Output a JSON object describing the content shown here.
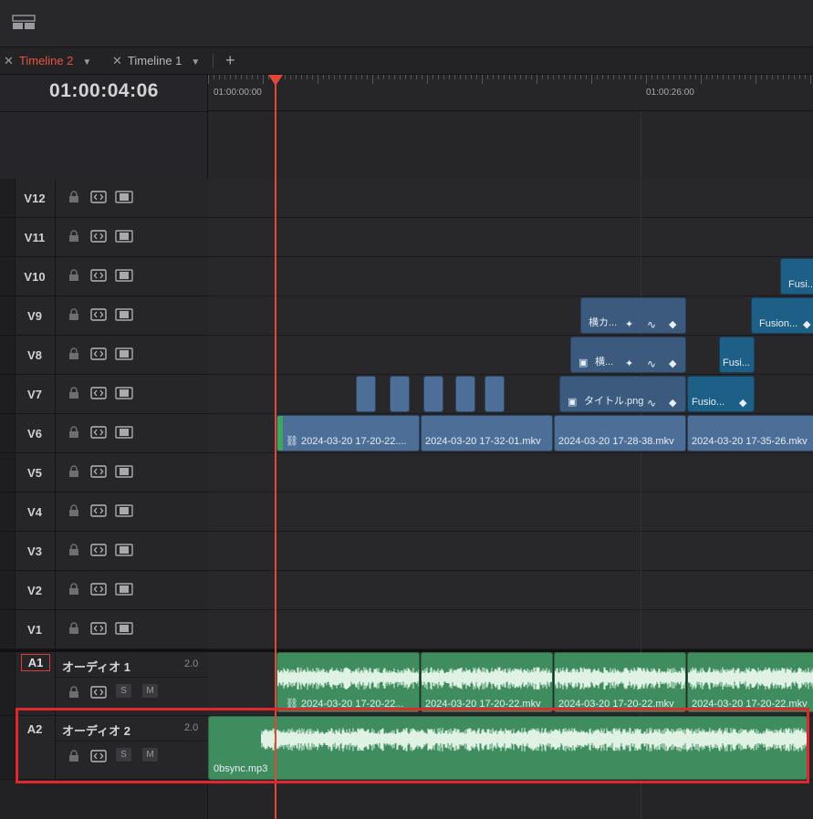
{
  "toolbar": {
    "layout_icon": "timeline-layout-icon"
  },
  "tabs": [
    {
      "label": "Timeline 2",
      "active": true
    },
    {
      "label": "Timeline 1",
      "active": false
    }
  ],
  "add_tab_label": "+",
  "timecode": "01:00:04:06",
  "ruler": {
    "marks": [
      "01:00:00:00",
      "01:00:26:00"
    ]
  },
  "video_tracks": [
    "V12",
    "V11",
    "V10",
    "V9",
    "V8",
    "V7",
    "V6",
    "V5",
    "V4",
    "V3",
    "V2",
    "V1"
  ],
  "audio_tracks": [
    {
      "id": "A1",
      "name": "オーディオ 1",
      "channels": "2.0",
      "solo": "S",
      "mute": "M"
    },
    {
      "id": "A2",
      "name": "オーディオ 2",
      "channels": "2.0",
      "solo": "S",
      "mute": "M"
    }
  ],
  "clips": {
    "v10_fusion": "Fusi...",
    "v9_title": "横カ...",
    "v9_fusion": "Fusion...",
    "v8_title": "横...",
    "v8_fusion": "Fusi...",
    "v7_title": "タイトル.png",
    "v7_fusion": "Fusio...",
    "v6": [
      "2024-03-20 17-20-22....",
      "2024-03-20 17-32-01.mkv",
      "2024-03-20 17-28-38.mkv",
      "2024-03-20 17-35-26.mkv"
    ],
    "a1": [
      "2024-03-20 17-20-22...",
      "2024-03-20 17-20-22.mkv",
      "2024-03-20 17-20-22.mkv",
      "2024-03-20 17-20-22.mkv"
    ],
    "a2": "0bsync.mp3"
  },
  "colors": {
    "playhead": "#e0493a",
    "active_tab": "#e8553e",
    "video_clip": "#4d6f97",
    "fusion_clip": "#1d5f86",
    "audio_clip": "#3f8d5f",
    "highlight_box": "#e2262e"
  }
}
